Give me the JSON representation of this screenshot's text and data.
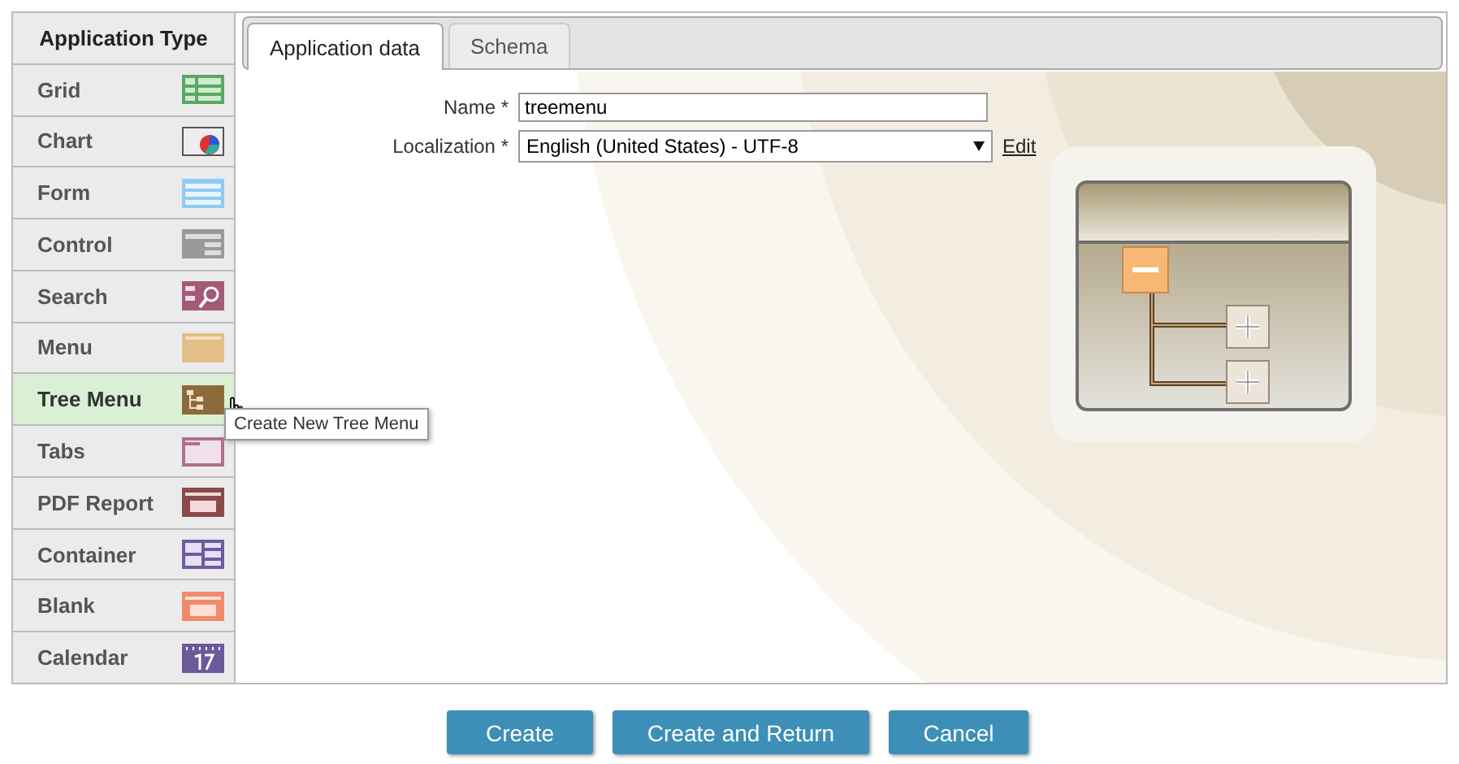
{
  "sidebar": {
    "title": "Application Type",
    "items": [
      {
        "label": "Grid",
        "selected": false
      },
      {
        "label": "Chart",
        "selected": false
      },
      {
        "label": "Form",
        "selected": false
      },
      {
        "label": "Control",
        "selected": false
      },
      {
        "label": "Search",
        "selected": false
      },
      {
        "label": "Menu",
        "selected": false
      },
      {
        "label": "Tree Menu",
        "selected": true
      },
      {
        "label": "Tabs",
        "selected": false
      },
      {
        "label": "PDF Report",
        "selected": false
      },
      {
        "label": "Container",
        "selected": false
      },
      {
        "label": "Blank",
        "selected": false
      },
      {
        "label": "Calendar",
        "selected": false
      }
    ],
    "tooltip": "Create New Tree Menu"
  },
  "tabs": [
    {
      "label": "Application data",
      "selected": true
    },
    {
      "label": "Schema",
      "selected": false
    }
  ],
  "form": {
    "name_label": "Name *",
    "name_value": "treemenu",
    "localization_label": "Localization *",
    "localization_value": "English (United States) - UTF-8",
    "edit_link": "Edit"
  },
  "buttons": [
    "Create",
    "Create and Return",
    "Cancel"
  ]
}
